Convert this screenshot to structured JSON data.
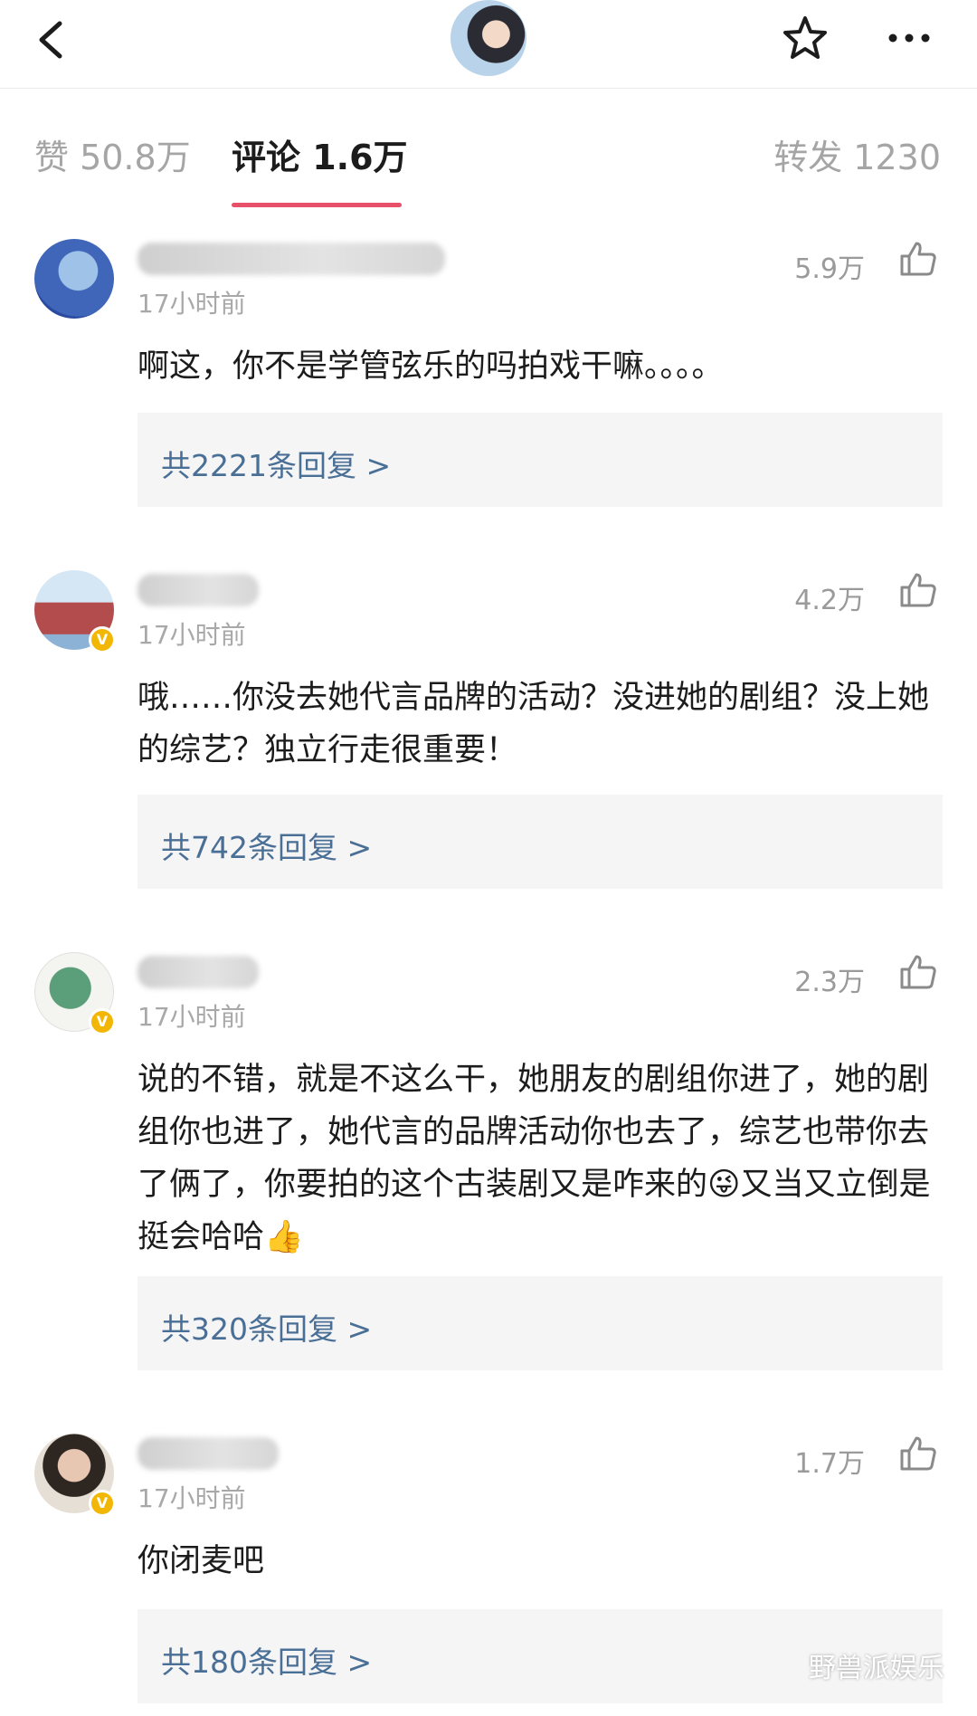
{
  "header": {
    "back_icon": "chevron-left-icon",
    "star_icon": "star-outline-icon",
    "more_icon": "ellipsis-icon"
  },
  "tabs": [
    {
      "label": "赞 50.8万"
    },
    {
      "label": "评论 1.6万"
    },
    {
      "label": "转发 1230"
    }
  ],
  "comments": [
    {
      "time": "17小时前",
      "likes": "5.9万",
      "text": "啊这，你不是学管弦乐的吗拍戏干嘛。。。。",
      "replies": "共2221条回复 >"
    },
    {
      "time": "17小时前",
      "likes": "4.2万",
      "text": "哦……你没去她代言品牌的活动？没进她的剧组？没上她的综艺？独立行走很重要！",
      "replies": "共742条回复 >"
    },
    {
      "time": "17小时前",
      "likes": "2.3万",
      "text": "说的不错，就是不这么干，她朋友的剧组你进了，她的剧组你也进了，她代言的品牌活动你也去了，综艺也带你去了俩了，你要拍的这个古装剧又是咋来的😜又当又立倒是挺会哈哈👍",
      "replies": "共320条回复 >"
    },
    {
      "time": "17小时前",
      "likes": "1.7万",
      "text": "你闭麦吧",
      "replies": "共180条回复 >"
    }
  ],
  "watermark": "野兽派娱乐",
  "colors": {
    "accent": "#e8506a",
    "reply_link": "#4a6f96",
    "verified_badge": "#f2b705"
  }
}
